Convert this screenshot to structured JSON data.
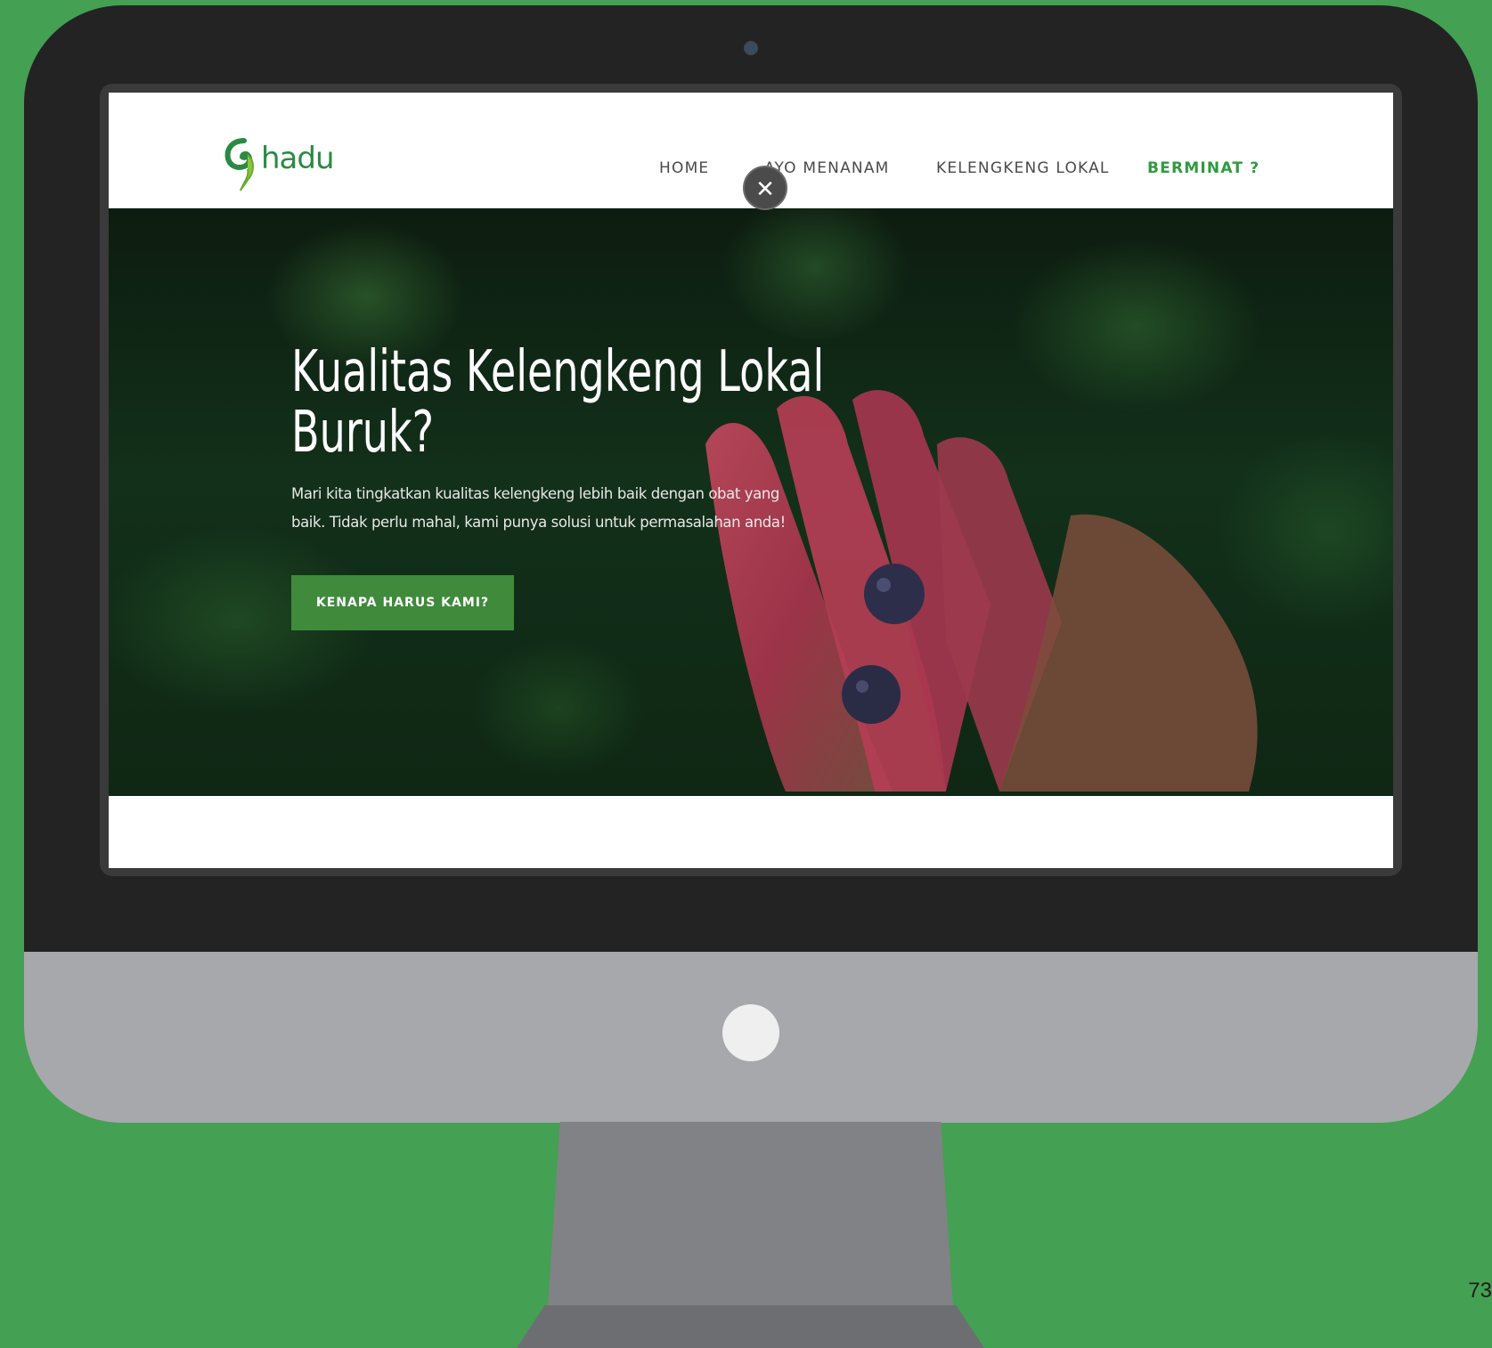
{
  "page": {
    "number": "73"
  },
  "site": {
    "logo_text": "hadu",
    "nav": [
      {
        "label": "HOME"
      },
      {
        "label": "AYO MENANAM"
      },
      {
        "label": "KELENGKENG LOKAL"
      },
      {
        "label": "BERMINAT ?"
      }
    ],
    "close_label": "✕"
  },
  "hero": {
    "title_line1": "Kualitas Kelengkeng Lokal",
    "title_line2": "Buruk?",
    "subtitle_line1": "Mari kita tingkatkan kualitas kelengkeng lebih baik dengan obat yang",
    "subtitle_line2": "baik. Tidak perlu mahal, kami punya solusi untuk permasalahan anda!",
    "cta_label": "KENAPA HARUS KAMI?"
  },
  "colors": {
    "background": "#44a052",
    "bezel": "#232323",
    "chin": "#a7a8ab",
    "brand_green": "#2f9a3f",
    "cta": "#3f8a3b"
  },
  "icons": {
    "logo": "hadu-leaf-logo-icon",
    "close": "close-icon"
  }
}
